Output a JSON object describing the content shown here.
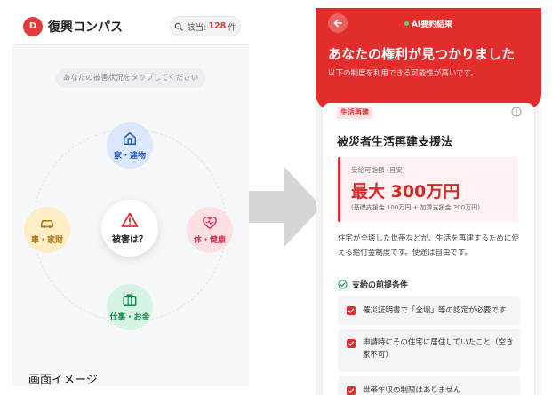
{
  "left_screen": {
    "logo_letter": "D",
    "app_title": "復興コンパス",
    "count_prefix": "該当:",
    "count_value": "128",
    "count_suffix": "件",
    "instruction": "あなたの被害状況をタップしてください",
    "categories": [
      {
        "label": "家・建物",
        "icon": "home-icon",
        "color": "#2c5fb8"
      },
      {
        "label": "車・家財",
        "icon": "car-icon",
        "color": "#b0710b"
      },
      {
        "label": "体・健康",
        "icon": "heart-pulse-icon",
        "color": "#d23a55"
      },
      {
        "label": "仕事・お金",
        "icon": "briefcase-icon",
        "color": "#17894c"
      }
    ],
    "center_label": "被害は？",
    "center_icon": "warning-icon",
    "caption": "画面イメージ"
  },
  "right_screen": {
    "header_label": "AI要約結果",
    "title": "あなたの権利が見つかりました",
    "subtitle": "以下の制度を利用できる可能性が高いです。",
    "card": {
      "category": "生活再建",
      "title": "被災者生活再建支援法",
      "amount_label": "受給可能額 (目安)",
      "amount": "最大 300万円",
      "amount_note": "(基礎支援金 100万円 + 加算支援金 200万円)",
      "description": "住宅が全壊した世帯などが、生活を再建するために使える給付金制度です。使途は自由です。",
      "conditions_title": "支給の前提条件",
      "conditions": [
        "罹災証明書で「全壊」等の認定が必要です",
        "申請時にその住宅に居住していたこと（空き家不可）",
        "世帯年収の制限はありません"
      ]
    }
  },
  "colors": {
    "accent_red": "#e22d2d",
    "home_blue": "#2c5fb8",
    "car_amber": "#b0710b",
    "health_pink": "#d23a55",
    "work_green": "#17894c"
  }
}
